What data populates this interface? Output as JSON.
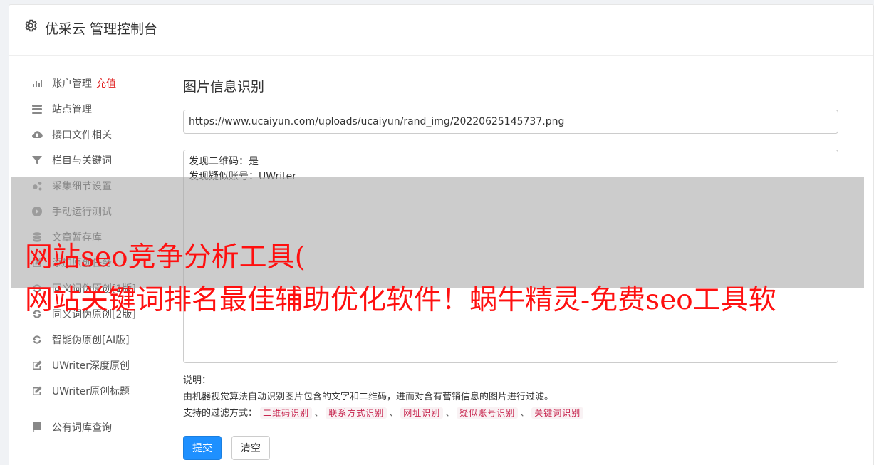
{
  "header": {
    "icon": "gear-icon",
    "title": "优采云 管理控制台"
  },
  "sidebar": {
    "items": [
      {
        "icon": "bar-chart-icon",
        "label": "账户管理",
        "extra": "充值"
      },
      {
        "icon": "server-icon",
        "label": "站点管理"
      },
      {
        "icon": "cloud-upload-icon",
        "label": "接口文件相关"
      },
      {
        "icon": "filter-icon",
        "label": "栏目与关键词"
      },
      {
        "icon": "cogs-icon",
        "label": "采集细节设置"
      },
      {
        "icon": "play-circle-icon",
        "label": "手动运行测试"
      },
      {
        "icon": "database-icon",
        "label": "文章暂存库"
      },
      {
        "icon": "edit-icon",
        "label": "添加原创任务"
      },
      {
        "icon": "refresh-icon",
        "label": "同义词伪原创[1版]"
      },
      {
        "icon": "refresh-icon",
        "label": "同义词伪原创[2版]"
      },
      {
        "icon": "refresh-icon",
        "label": "智能伪原创[AI版]"
      },
      {
        "icon": "edit-icon",
        "label": "UWriter深度原创"
      },
      {
        "icon": "edit-icon",
        "label": "UWriter原创标题"
      }
    ],
    "bottom_items": [
      {
        "icon": "book-icon",
        "label": "公有词库查询"
      }
    ]
  },
  "main": {
    "title": "图片信息识别",
    "url_value": "https://www.ucaiyun.com/uploads/ucaiyun/rand_img/20220625145737.png",
    "result_lines": [
      "发现二维码：是",
      "发现疑似账号：UWriter"
    ],
    "desc_label": "说明：",
    "desc_text": "由机器视觉算法自动识别图片包含的文字和二维码，进而对含有营销信息的图片进行过滤。",
    "filter_label": "支持的过滤方式：",
    "filter_tags": [
      "二维码识别",
      "联系方式识别",
      "网址识别",
      "疑似账号识别",
      "关键词识别"
    ],
    "separator": "、",
    "submit_label": "提交",
    "clear_label": "清空"
  },
  "overlay": {
    "line1": "网站seo竞争分析工具(",
    "line2": "网站关键词排名最佳辅助优化软件！蜗牛精灵-免费seo工具软"
  },
  "colors": {
    "accent": "#1e90ff",
    "recharge": "#e02020",
    "overlay_text": "#ff1010",
    "tag_text": "#c7254e",
    "tag_bg": "#f9f2f4"
  }
}
